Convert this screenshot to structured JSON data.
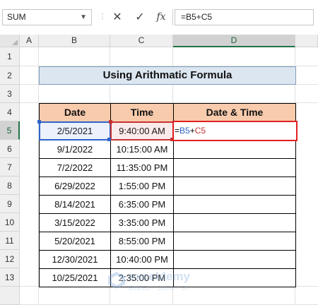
{
  "formula_bar": {
    "name_box": "SUM",
    "cancel_icon": "✕",
    "enter_icon": "✓",
    "fx_label": "fx",
    "formula": "=B5+C5"
  },
  "columns": [
    "A",
    "B",
    "C",
    "D"
  ],
  "rows": [
    "1",
    "2",
    "3",
    "4",
    "5",
    "6",
    "7",
    "8",
    "9",
    "10",
    "11",
    "12",
    "13"
  ],
  "title": "Using Arithmatic Formula",
  "table": {
    "headers": [
      "Date",
      "Time",
      "Date & Time"
    ],
    "rows": [
      {
        "date": "2/5/2021",
        "time": "9:40:00 AM",
        "datetime": ""
      },
      {
        "date": "9/1/2022",
        "time": "10:15:00 AM",
        "datetime": ""
      },
      {
        "date": "7/2/2022",
        "time": "11:35:00 PM",
        "datetime": ""
      },
      {
        "date": "6/29/2022",
        "time": "1:55:00 PM",
        "datetime": ""
      },
      {
        "date": "8/14/2021",
        "time": "6:35:00 PM",
        "datetime": ""
      },
      {
        "date": "3/15/2022",
        "time": "3:35:00 PM",
        "datetime": ""
      },
      {
        "date": "5/20/2021",
        "time": "8:55:00 PM",
        "datetime": ""
      },
      {
        "date": "12/30/2021",
        "time": "10:40:00 PM",
        "datetime": ""
      },
      {
        "date": "10/25/2021",
        "time": "2:35:00 PM",
        "datetime": ""
      }
    ]
  },
  "editing": {
    "eq": "=",
    "ref1": "B5",
    "plus": "+",
    "ref2": "C5"
  },
  "selected_row": "5",
  "selected_col": "D",
  "watermark": {
    "name": "exceldemy",
    "tagline": "EXCEL · DATA · BI"
  },
  "colors": {
    "header_fill": "#f8cbad",
    "title_fill": "#dce6f1",
    "ref1_color": "#2e64c8",
    "ref2_color": "#c83232",
    "active_border": "#e02020"
  }
}
